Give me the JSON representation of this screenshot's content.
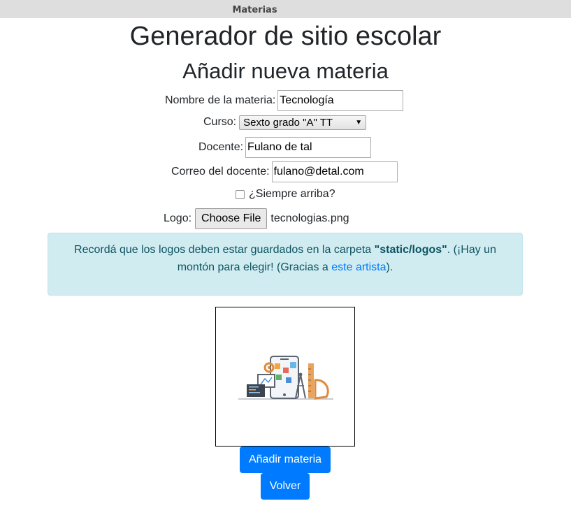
{
  "tab": {
    "title": "Materias"
  },
  "header": {
    "site_title": "Generador de sitio escolar",
    "page_title": "Añadir nueva materia"
  },
  "form": {
    "nombre": {
      "label": "Nombre de la materia:",
      "value": "Tecnología"
    },
    "curso": {
      "label": "Curso:",
      "selected": "Sexto grado \"A\" TT"
    },
    "docente": {
      "label": "Docente:",
      "value": "Fulano de tal"
    },
    "correo": {
      "label": "Correo del docente:",
      "value": "fulano@detal.com"
    },
    "siempre_arriba": {
      "label": "¿Siempre arriba?",
      "checked": false
    },
    "logo": {
      "label": "Logo:",
      "button": "Choose File",
      "file_name": "tecnologias.png"
    }
  },
  "alert": {
    "text_before": "Recordá que los logos deben estar guardados en la carpeta ",
    "folder": "\"static/logos\"",
    "text_middle": ". (¡Hay un montón para elegir! (Gracias a ",
    "link": "este artista",
    "text_after": ")."
  },
  "preview": {
    "icon": "technology-illustration-icon"
  },
  "buttons": {
    "add": "Añadir materia",
    "back": "Volver"
  },
  "colors": {
    "primary": "#007bff",
    "alert_bg": "#d1ecf1",
    "alert_text": "#0c5460"
  }
}
